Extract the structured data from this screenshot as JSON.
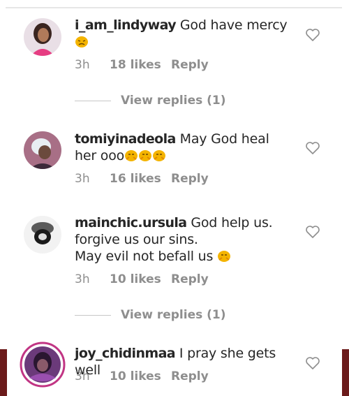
{
  "comments": [
    {
      "username": "i_am_lindyway",
      "text": "God have mercy",
      "emoji_count": 1,
      "time": "3h",
      "likes": "18 likes",
      "reply": "Reply",
      "view_replies": "View replies (1)"
    },
    {
      "username": "tomiyinadeola",
      "text": "May God heal her ooo",
      "emoji_count": 3,
      "time": "3h",
      "likes": "16 likes",
      "reply": "Reply"
    },
    {
      "username": "mainchic.ursula",
      "text_lines": [
        "God help us.",
        "forgive us our sins.",
        "May evil not befall us"
      ],
      "emoji_count": 1,
      "time": "3h",
      "likes": "10 likes",
      "reply": "Reply",
      "view_replies": "View replies (1)"
    },
    {
      "username": "joy_chidinmaa",
      "text": "I pray she gets well",
      "emoji_count": 0,
      "time": "3h",
      "likes": "10 likes",
      "reply": "Reply"
    }
  ],
  "icons": {
    "like": "heart-outline-icon",
    "emoji": "face-emoji-icon"
  },
  "colors": {
    "text": "#262626",
    "meta": "#8e8e8e",
    "story_ring": "#c13584",
    "emoji": "#f4b400"
  }
}
